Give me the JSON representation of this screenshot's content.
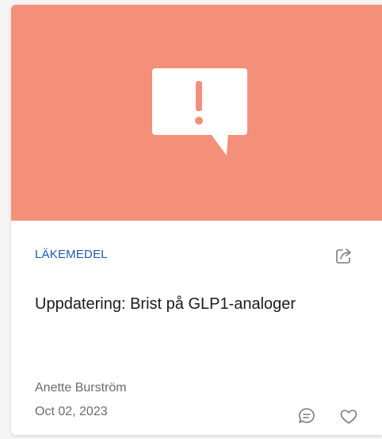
{
  "card": {
    "category": "LÄKEMEDEL",
    "title": "Uppdatering: Brist på GLP1-analoger",
    "author": "Anette Burström",
    "date": "Oct 02, 2023",
    "hero_icon": "speech-bubble-exclamation-icon",
    "icons": {
      "share": "share-icon",
      "comment": "comment-icon",
      "like": "heart-icon"
    }
  },
  "colors": {
    "hero_background": "#f4907a",
    "category": "#1e5aa8",
    "title": "#1b1b1b",
    "meta": "#6b6b6b"
  }
}
